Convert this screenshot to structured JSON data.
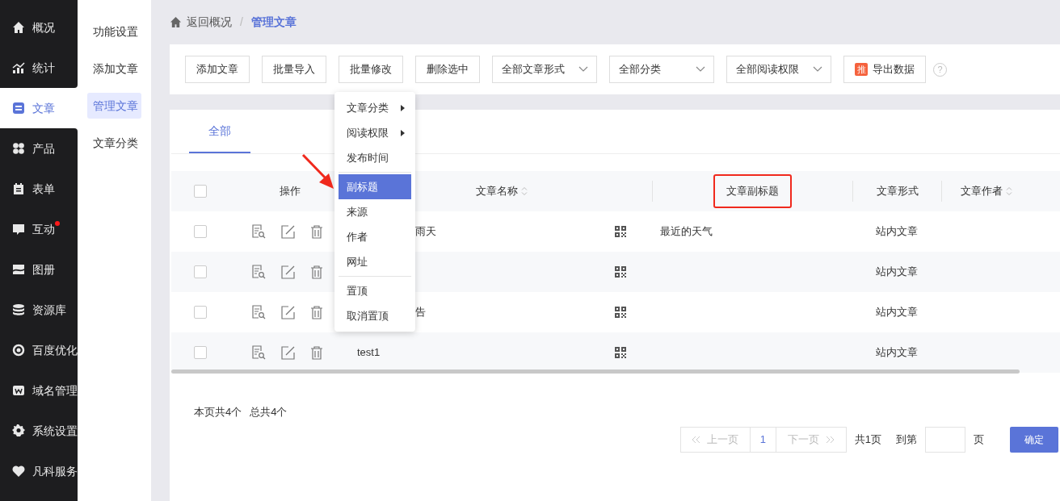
{
  "sidebar": {
    "items": [
      {
        "label": "概况",
        "selected": false,
        "badge": false
      },
      {
        "label": "统计",
        "selected": false,
        "badge": false
      },
      {
        "label": "文章",
        "selected": true,
        "badge": false
      },
      {
        "label": "产品",
        "selected": false,
        "badge": false
      },
      {
        "label": "表单",
        "selected": false,
        "badge": false
      },
      {
        "label": "互动",
        "selected": false,
        "badge": true
      },
      {
        "label": "图册",
        "selected": false,
        "badge": false
      },
      {
        "label": "资源库",
        "selected": false,
        "badge": false
      },
      {
        "label": "百度优化",
        "selected": false,
        "badge": false
      },
      {
        "label": "域名管理",
        "selected": false,
        "badge": false
      },
      {
        "label": "系统设置",
        "selected": false,
        "badge": false
      },
      {
        "label": "凡科服务",
        "selected": false,
        "badge": false
      }
    ]
  },
  "subnav": {
    "items": [
      {
        "label": "功能设置",
        "selected": false
      },
      {
        "label": "添加文章",
        "selected": false
      },
      {
        "label": "管理文章",
        "selected": true
      },
      {
        "label": "文章分类",
        "selected": false
      }
    ]
  },
  "breadcrumb": {
    "back": "返回概况",
    "separator": "/",
    "current": "管理文章"
  },
  "toolbar": {
    "buttons": [
      "添加文章",
      "批量导入",
      "批量修改",
      "删除选中"
    ],
    "selects": [
      "全部文章形式",
      "全部分类",
      "全部阅读权限"
    ],
    "export": {
      "badge": "推",
      "label": "导出数据"
    },
    "help": "?"
  },
  "tabs": [
    {
      "label": "全部",
      "selected": true
    }
  ],
  "table": {
    "select_all_checked": false,
    "columns": [
      {
        "label": "操作",
        "sortable": false,
        "highlighted": false
      },
      {
        "label": "文章名称",
        "sortable": true,
        "highlighted": false
      },
      {
        "label": "文章副标题",
        "sortable": false,
        "highlighted": true
      },
      {
        "label": "文章形式",
        "sortable": false,
        "highlighted": false
      },
      {
        "label": "文章作者",
        "sortable": true,
        "highlighted": false
      }
    ],
    "rows": [
      {
        "kind": "covered",
        "checked": false,
        "name": "雨天",
        "subtitle": "最近的天气",
        "form": "站内文章"
      },
      {
        "kind": "covered",
        "checked": false,
        "subtitle": "",
        "form": "站内文章"
      },
      {
        "kind": "covered",
        "checked": false,
        "name": "告",
        "subtitle": "",
        "form": "站内文章"
      },
      {
        "kind": "plain",
        "checked": false,
        "name": "test1",
        "subtitle": "",
        "form": "站内文章"
      }
    ]
  },
  "menu": {
    "items": [
      {
        "kind": "submenu",
        "label": "文章分类",
        "selected": false
      },
      {
        "kind": "submenu",
        "label": "阅读权限",
        "selected": false
      },
      {
        "kind": "item",
        "label": "发布时间",
        "selected": false
      },
      {
        "kind": "divider"
      },
      {
        "kind": "item",
        "label": "副标题",
        "selected": true
      },
      {
        "kind": "item",
        "label": "来源",
        "selected": false
      },
      {
        "kind": "item",
        "label": "作者",
        "selected": false
      },
      {
        "kind": "item",
        "label": "网址",
        "selected": false
      },
      {
        "kind": "divider"
      },
      {
        "kind": "item",
        "label": "置顶",
        "selected": false
      },
      {
        "kind": "item",
        "label": "取消置顶",
        "selected": false
      }
    ]
  },
  "footer": {
    "page_count": "本页共4个",
    "total": "总共4个"
  },
  "pagination": {
    "prev": "上一页",
    "pages": [
      {
        "label": "1",
        "selected": true
      }
    ],
    "next": "下一页",
    "total_pages": "共1页",
    "goto": "到第",
    "page_unit": "页",
    "confirm": "确定"
  }
}
